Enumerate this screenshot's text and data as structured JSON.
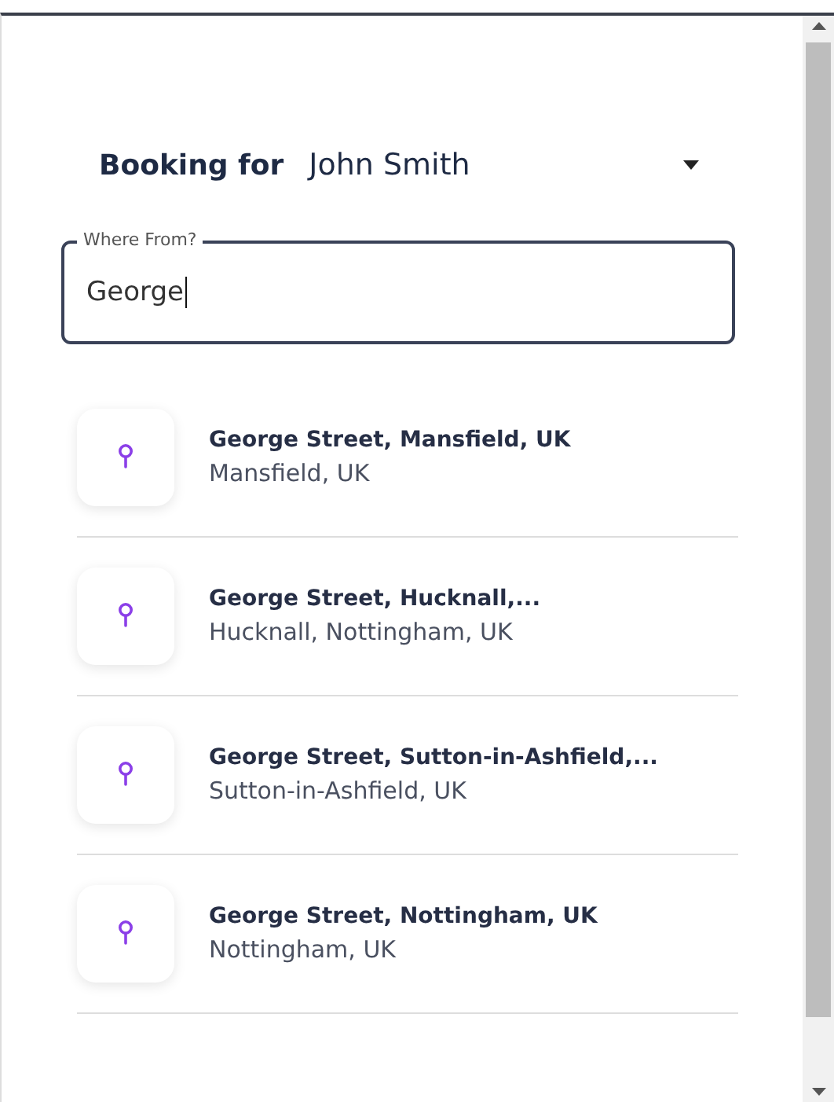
{
  "booking": {
    "label": "Booking for",
    "value": "John Smith"
  },
  "from_field": {
    "label": "Where From?",
    "value": "George",
    "focused": true
  },
  "suggestions": [
    {
      "title": "George Street, Mansfield, UK",
      "subtitle": "Mansfield, UK"
    },
    {
      "title": "George Street, Hucknall,...",
      "subtitle": "Hucknall, Nottingham, UK"
    },
    {
      "title": "George Street, Sutton-in-Ashfield,...",
      "subtitle": "Sutton-in-Ashfield, UK"
    },
    {
      "title": "George Street, Nottingham, UK",
      "subtitle": "Nottingham, UK"
    }
  ]
}
